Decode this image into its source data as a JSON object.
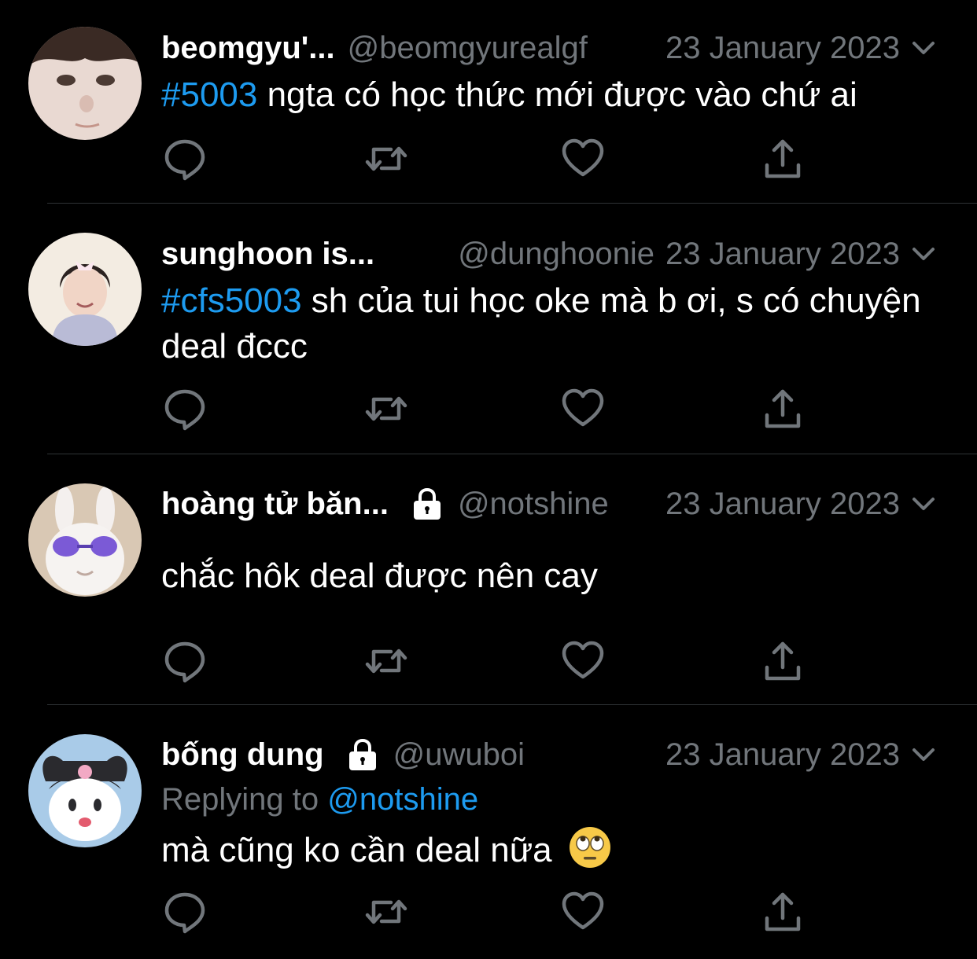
{
  "colors": {
    "background": "#000000",
    "text": "#ffffff",
    "secondary": "#71767b",
    "accent": "#1d9bf0",
    "divider": "#2f3336"
  },
  "tweets": [
    {
      "name": "beomgyu'...",
      "locked": false,
      "handle": "@beomgyurealgf",
      "date": "23 January 2023",
      "hashtag": "#5003",
      "text": " ngta có học thức mới được vào chứ ai",
      "actions": [
        "reply-icon",
        "retweet-icon",
        "like-icon",
        "share-icon"
      ]
    },
    {
      "name": "sunghoon is...",
      "locked": false,
      "handle": "@dunghoonie",
      "date": "23 January 2023",
      "hashtag": "#cfs5003",
      "text": " sh của tui học oke mà b ơi, s có chuyện deal đccc",
      "actions": [
        "reply-icon",
        "retweet-icon",
        "like-icon",
        "share-icon"
      ]
    },
    {
      "name": "hoàng tử băn...",
      "locked": true,
      "handle": "@notshine",
      "date": "23 January 2023",
      "hashtag": "",
      "text": "chắc hôk deal được nên cay",
      "actions": [
        "reply-icon",
        "retweet-icon",
        "like-icon",
        "share-icon"
      ]
    },
    {
      "name": "bống dung",
      "locked": true,
      "handle": "@uwuboi",
      "date": "23 January 2023",
      "replying_prefix": "Replying to ",
      "replying_to": "@notshine",
      "hashtag": "",
      "text": "mà cũng ko cần deal nữa",
      "emoji": "eye-roll-emoji",
      "actions": [
        "reply-icon",
        "retweet-icon",
        "like-icon",
        "share-icon"
      ]
    }
  ]
}
